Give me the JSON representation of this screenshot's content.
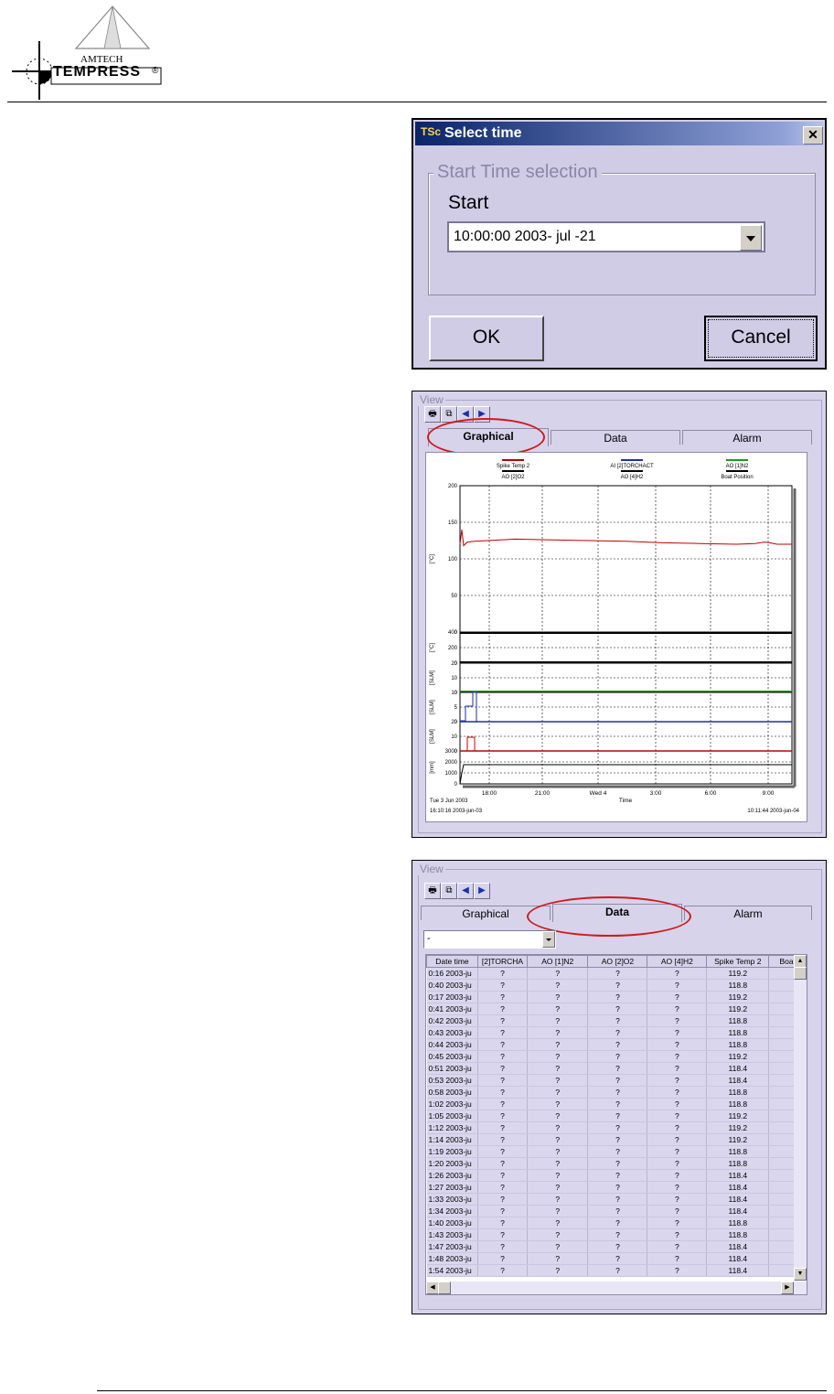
{
  "header": {
    "brand_top": "AMTECH",
    "brand_main": "TEMPRESS",
    "registered": "®"
  },
  "dialog": {
    "title_icon": "TSc",
    "title": "Select time",
    "close_label": "✕",
    "group_label": "Start Time selection",
    "start_label": "Start",
    "start_value": "10:00:00 2003- jul -21",
    "ok_label": "OK",
    "cancel_label": "Cancel"
  },
  "view_graph": {
    "legend": "View",
    "tabs": [
      "Graphical",
      "Data",
      "Alarm"
    ],
    "active_tab": "Graphical",
    "toolbar": [
      "printer-icon",
      "copy-icon",
      "arrow-left-icon",
      "arrow-right-icon"
    ]
  },
  "view_data": {
    "legend": "View",
    "tabs": [
      "Graphical",
      "Data",
      "Alarm"
    ],
    "active_tab": "Data",
    "filter_value": "-",
    "columns": [
      "Date time",
      "[2]TORCHA",
      "AO  [1]N2",
      "AO  [2]O2",
      "AO  [4]H2",
      "Spike Temp 2",
      "Boat"
    ],
    "rows": [
      [
        "0:16 2003-ju",
        "?",
        "?",
        "?",
        "?",
        "119.2"
      ],
      [
        "0:40 2003-ju",
        "?",
        "?",
        "?",
        "?",
        "118.8"
      ],
      [
        "0:17 2003-ju",
        "?",
        "?",
        "?",
        "?",
        "119.2"
      ],
      [
        "0:41 2003-ju",
        "?",
        "?",
        "?",
        "?",
        "119.2"
      ],
      [
        "0:42 2003-ju",
        "?",
        "?",
        "?",
        "?",
        "118.8"
      ],
      [
        "0:43 2003-ju",
        "?",
        "?",
        "?",
        "?",
        "118.8"
      ],
      [
        "0:44 2003-ju",
        "?",
        "?",
        "?",
        "?",
        "118.8"
      ],
      [
        "0:45 2003-ju",
        "?",
        "?",
        "?",
        "?",
        "119.2"
      ],
      [
        "0:51 2003-ju",
        "?",
        "?",
        "?",
        "?",
        "118.4"
      ],
      [
        "0:53 2003-ju",
        "?",
        "?",
        "?",
        "?",
        "118.4"
      ],
      [
        "0:58 2003-ju",
        "?",
        "?",
        "?",
        "?",
        "118.8"
      ],
      [
        "1:02 2003-ju",
        "?",
        "?",
        "?",
        "?",
        "118.8"
      ],
      [
        "1:05 2003-ju",
        "?",
        "?",
        "?",
        "?",
        "119.2"
      ],
      [
        "1:12 2003-ju",
        "?",
        "?",
        "?",
        "?",
        "119.2"
      ],
      [
        "1:14 2003-ju",
        "?",
        "?",
        "?",
        "?",
        "119.2"
      ],
      [
        "1:19 2003-ju",
        "?",
        "?",
        "?",
        "?",
        "118.8"
      ],
      [
        "1:20 2003-ju",
        "?",
        "?",
        "?",
        "?",
        "118.8"
      ],
      [
        "1:26 2003-ju",
        "?",
        "?",
        "?",
        "?",
        "118.4"
      ],
      [
        "1:27 2003-ju",
        "?",
        "?",
        "?",
        "?",
        "118.4"
      ],
      [
        "1:33 2003-ju",
        "?",
        "?",
        "?",
        "?",
        "118.4"
      ],
      [
        "1:34 2003-ju",
        "?",
        "?",
        "?",
        "?",
        "118.4"
      ],
      [
        "1:40 2003-ju",
        "?",
        "?",
        "?",
        "?",
        "118.8"
      ],
      [
        "1:43 2003-ju",
        "?",
        "?",
        "?",
        "?",
        "118.8"
      ],
      [
        "1:47 2003-ju",
        "?",
        "?",
        "?",
        "?",
        "118.4"
      ],
      [
        "1:48 2003-ju",
        "?",
        "?",
        "?",
        "?",
        "118.4"
      ],
      [
        "1:54 2003-ju",
        "?",
        "?",
        "?",
        "?",
        "118.4"
      ]
    ]
  },
  "chart_data": {
    "type": "line",
    "legend": [
      {
        "name": "Spike Temp 2",
        "color": "#c00000"
      },
      {
        "name": "AI [2]TORCHACT",
        "color": "#1a2faa"
      },
      {
        "name": "AO [1]N2",
        "color": "#1a9a1a"
      },
      {
        "name": "AO [2]O2",
        "color": "#000000"
      },
      {
        "name": "AO [4]H2",
        "color": "#000000"
      },
      {
        "name": "Boat Position",
        "color": "#000000"
      }
    ],
    "xlabel": "Time",
    "x_ticks": [
      "18:00",
      "21:00",
      "Wed 4",
      "3:00",
      "6:00",
      "9:00"
    ],
    "start_label_1": "Tue 3 Jun 2003",
    "start_label_2": "16:10:16 2003-jun-03",
    "end_label": "10:11:44 2003-jun-04",
    "panels": [
      {
        "unit": "[°C]",
        "ticks": [
          "200",
          "150",
          "100",
          "50",
          "0"
        ],
        "ylim": [
          0,
          200
        ]
      },
      {
        "unit": "[°C]",
        "ticks": [
          "400",
          "200",
          "0"
        ],
        "ylim": [
          0,
          400
        ]
      },
      {
        "unit": "[SLM]",
        "ticks": [
          "20",
          "10",
          "0"
        ],
        "ylim": [
          0,
          20
        ]
      },
      {
        "unit": "[SLM]",
        "ticks": [
          "10",
          "5",
          "0"
        ],
        "ylim": [
          0,
          10
        ]
      },
      {
        "unit": "[SLM]",
        "ticks": [
          "20",
          "10",
          "0"
        ],
        "ylim": [
          0,
          20
        ]
      },
      {
        "unit": "[mm]",
        "ticks": [
          "3000",
          "2000",
          "1000",
          "0"
        ],
        "ylim": [
          0,
          3000
        ]
      }
    ],
    "series_main": {
      "name": "Spike Temp 2",
      "x_hours": [
        0,
        0.1,
        0.2,
        0.4,
        0.8,
        1.5,
        3,
        5,
        7,
        9,
        11,
        13,
        15,
        16,
        16.5,
        16.8,
        17.2,
        18
      ],
      "y": [
        120,
        140,
        118,
        123,
        124,
        125,
        127,
        126,
        125,
        124,
        122,
        121,
        120,
        121,
        123,
        122,
        120,
        120
      ]
    }
  }
}
